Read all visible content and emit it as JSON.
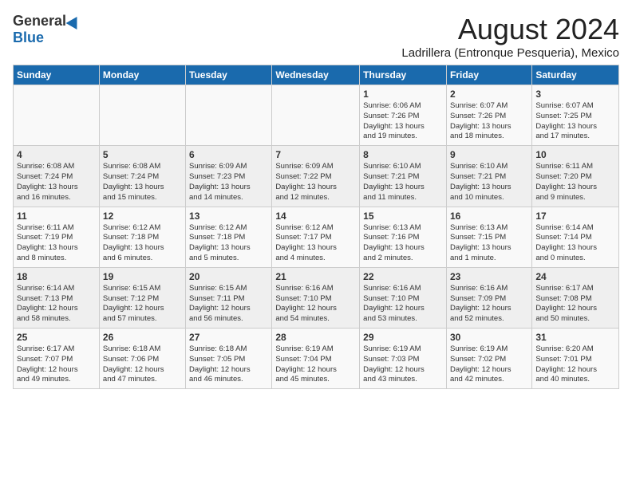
{
  "logo": {
    "general": "General",
    "blue": "Blue"
  },
  "header": {
    "month": "August 2024",
    "location": "Ladrillera (Entronque Pesqueria), Mexico"
  },
  "days_header": [
    "Sunday",
    "Monday",
    "Tuesday",
    "Wednesday",
    "Thursday",
    "Friday",
    "Saturday"
  ],
  "weeks": [
    [
      {
        "day": "",
        "text": ""
      },
      {
        "day": "",
        "text": ""
      },
      {
        "day": "",
        "text": ""
      },
      {
        "day": "",
        "text": ""
      },
      {
        "day": "1",
        "text": "Sunrise: 6:06 AM\nSunset: 7:26 PM\nDaylight: 13 hours\nand 19 minutes."
      },
      {
        "day": "2",
        "text": "Sunrise: 6:07 AM\nSunset: 7:26 PM\nDaylight: 13 hours\nand 18 minutes."
      },
      {
        "day": "3",
        "text": "Sunrise: 6:07 AM\nSunset: 7:25 PM\nDaylight: 13 hours\nand 17 minutes."
      }
    ],
    [
      {
        "day": "4",
        "text": "Sunrise: 6:08 AM\nSunset: 7:24 PM\nDaylight: 13 hours\nand 16 minutes."
      },
      {
        "day": "5",
        "text": "Sunrise: 6:08 AM\nSunset: 7:24 PM\nDaylight: 13 hours\nand 15 minutes."
      },
      {
        "day": "6",
        "text": "Sunrise: 6:09 AM\nSunset: 7:23 PM\nDaylight: 13 hours\nand 14 minutes."
      },
      {
        "day": "7",
        "text": "Sunrise: 6:09 AM\nSunset: 7:22 PM\nDaylight: 13 hours\nand 12 minutes."
      },
      {
        "day": "8",
        "text": "Sunrise: 6:10 AM\nSunset: 7:21 PM\nDaylight: 13 hours\nand 11 minutes."
      },
      {
        "day": "9",
        "text": "Sunrise: 6:10 AM\nSunset: 7:21 PM\nDaylight: 13 hours\nand 10 minutes."
      },
      {
        "day": "10",
        "text": "Sunrise: 6:11 AM\nSunset: 7:20 PM\nDaylight: 13 hours\nand 9 minutes."
      }
    ],
    [
      {
        "day": "11",
        "text": "Sunrise: 6:11 AM\nSunset: 7:19 PM\nDaylight: 13 hours\nand 8 minutes."
      },
      {
        "day": "12",
        "text": "Sunrise: 6:12 AM\nSunset: 7:18 PM\nDaylight: 13 hours\nand 6 minutes."
      },
      {
        "day": "13",
        "text": "Sunrise: 6:12 AM\nSunset: 7:18 PM\nDaylight: 13 hours\nand 5 minutes."
      },
      {
        "day": "14",
        "text": "Sunrise: 6:12 AM\nSunset: 7:17 PM\nDaylight: 13 hours\nand 4 minutes."
      },
      {
        "day": "15",
        "text": "Sunrise: 6:13 AM\nSunset: 7:16 PM\nDaylight: 13 hours\nand 2 minutes."
      },
      {
        "day": "16",
        "text": "Sunrise: 6:13 AM\nSunset: 7:15 PM\nDaylight: 13 hours\nand 1 minute."
      },
      {
        "day": "17",
        "text": "Sunrise: 6:14 AM\nSunset: 7:14 PM\nDaylight: 13 hours\nand 0 minutes."
      }
    ],
    [
      {
        "day": "18",
        "text": "Sunrise: 6:14 AM\nSunset: 7:13 PM\nDaylight: 12 hours\nand 58 minutes."
      },
      {
        "day": "19",
        "text": "Sunrise: 6:15 AM\nSunset: 7:12 PM\nDaylight: 12 hours\nand 57 minutes."
      },
      {
        "day": "20",
        "text": "Sunrise: 6:15 AM\nSunset: 7:11 PM\nDaylight: 12 hours\nand 56 minutes."
      },
      {
        "day": "21",
        "text": "Sunrise: 6:16 AM\nSunset: 7:10 PM\nDaylight: 12 hours\nand 54 minutes."
      },
      {
        "day": "22",
        "text": "Sunrise: 6:16 AM\nSunset: 7:10 PM\nDaylight: 12 hours\nand 53 minutes."
      },
      {
        "day": "23",
        "text": "Sunrise: 6:16 AM\nSunset: 7:09 PM\nDaylight: 12 hours\nand 52 minutes."
      },
      {
        "day": "24",
        "text": "Sunrise: 6:17 AM\nSunset: 7:08 PM\nDaylight: 12 hours\nand 50 minutes."
      }
    ],
    [
      {
        "day": "25",
        "text": "Sunrise: 6:17 AM\nSunset: 7:07 PM\nDaylight: 12 hours\nand 49 minutes."
      },
      {
        "day": "26",
        "text": "Sunrise: 6:18 AM\nSunset: 7:06 PM\nDaylight: 12 hours\nand 47 minutes."
      },
      {
        "day": "27",
        "text": "Sunrise: 6:18 AM\nSunset: 7:05 PM\nDaylight: 12 hours\nand 46 minutes."
      },
      {
        "day": "28",
        "text": "Sunrise: 6:19 AM\nSunset: 7:04 PM\nDaylight: 12 hours\nand 45 minutes."
      },
      {
        "day": "29",
        "text": "Sunrise: 6:19 AM\nSunset: 7:03 PM\nDaylight: 12 hours\nand 43 minutes."
      },
      {
        "day": "30",
        "text": "Sunrise: 6:19 AM\nSunset: 7:02 PM\nDaylight: 12 hours\nand 42 minutes."
      },
      {
        "day": "31",
        "text": "Sunrise: 6:20 AM\nSunset: 7:01 PM\nDaylight: 12 hours\nand 40 minutes."
      }
    ]
  ]
}
